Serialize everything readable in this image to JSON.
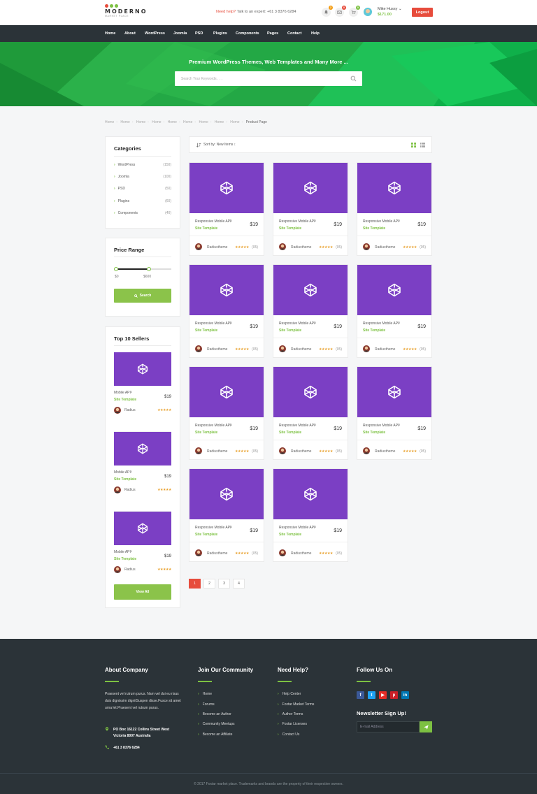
{
  "brand": {
    "name": "MODERNO",
    "tagline": "MARKET PLACE",
    "dot_colors": [
      "#e74c3c",
      "#7dc142",
      "#7dc142"
    ]
  },
  "header": {
    "help_prefix": "Need help?",
    "help_text": "Talk to an expert: +61 3 8376 6284",
    "notifications_count": "2",
    "messages_count": "0",
    "cart_count": "0",
    "user_name": "Mike Hussy",
    "user_balance": "$171.00",
    "logout_label": "Logout"
  },
  "nav": {
    "items": [
      "Home",
      "About",
      "WordPress",
      "Joomla",
      "PSD",
      "Plugins",
      "Components",
      "Pages",
      "Contact",
      "Help"
    ]
  },
  "hero": {
    "title": "Premium WordPress Themes, Web Templates and Many More ...",
    "search_placeholder": "Search Your Keywords . . ."
  },
  "breadcrumb": {
    "items": [
      "Home",
      "Home",
      "Home",
      "Home",
      "Home",
      "Home",
      "Home",
      "Home",
      "Home"
    ],
    "current": "Product Page"
  },
  "categories": {
    "title": "Categories",
    "items": [
      {
        "label": "WordPress",
        "count": "(150)"
      },
      {
        "label": "Joomla",
        "count": "(100)"
      },
      {
        "label": "PSD",
        "count": "(50)"
      },
      {
        "label": "Plugins",
        "count": "(60)"
      },
      {
        "label": "Components",
        "count": "(40)"
      }
    ]
  },
  "price_range": {
    "title": "Price Range",
    "min_label": "$0",
    "max_label": "$600",
    "selected_fraction": 0.6,
    "search_label": "Search"
  },
  "top_sellers": {
    "title": "Top 10 Sellers",
    "items": [
      {
        "title": "Mobile API²",
        "category": "Site Template",
        "price": "$19",
        "author": "Radius",
        "stars": "★★★★★"
      },
      {
        "title": "Mobile API²",
        "category": "Site Template",
        "price": "$19",
        "author": "Radius",
        "stars": "★★★★★"
      },
      {
        "title": "Mobile API²",
        "category": "Site Template",
        "price": "$19",
        "author": "Radius",
        "stars": "★★★★★"
      }
    ],
    "view_all_label": "View All"
  },
  "sort": {
    "label": "Sort by: New Items ↕"
  },
  "products": [
    {
      "title": "Responsive Mobile API²",
      "category": "Site Template",
      "price": "$19",
      "author": "Radiustheme",
      "stars": "★★★★★",
      "reviews": "(05)"
    },
    {
      "title": "Responsive Mobile API²",
      "category": "Site Template",
      "price": "$19",
      "author": "Radiustheme",
      "stars": "★★★★★",
      "reviews": "(05)"
    },
    {
      "title": "Responsive Mobile API²",
      "category": "Site Template",
      "price": "$19",
      "author": "Radiustheme",
      "stars": "★★★★★",
      "reviews": "(05)"
    },
    {
      "title": "Responsive Mobile API²",
      "category": "Site Template",
      "price": "$19",
      "author": "Radiustheme",
      "stars": "★★★★★",
      "reviews": "(05)"
    },
    {
      "title": "Responsive Mobile API²",
      "category": "Site Template",
      "price": "$19",
      "author": "Radiustheme",
      "stars": "★★★★★",
      "reviews": "(05)"
    },
    {
      "title": "Responsive Mobile API²",
      "category": "Site Template",
      "price": "$19",
      "author": "Radiustheme",
      "stars": "★★★★★",
      "reviews": "(05)"
    },
    {
      "title": "Responsive Mobile API²",
      "category": "Site Template",
      "price": "$19",
      "author": "Radiustheme",
      "stars": "★★★★★",
      "reviews": "(05)"
    },
    {
      "title": "Responsive Mobile API²",
      "category": "Site Template",
      "price": "$19",
      "author": "Radiustheme",
      "stars": "★★★★★",
      "reviews": "(05)"
    },
    {
      "title": "Responsive Mobile API²",
      "category": "Site Template",
      "price": "$19",
      "author": "Radiustheme",
      "stars": "★★★★★",
      "reviews": "(05)"
    },
    {
      "title": "Responsive Mobile API²",
      "category": "Site Template",
      "price": "$19",
      "author": "Radiustheme",
      "stars": "★★★★★",
      "reviews": "(05)"
    },
    {
      "title": "Responsive Mobile API²",
      "category": "Site Template",
      "price": "$19",
      "author": "Radiustheme",
      "stars": "★★★★★",
      "reviews": "(05)"
    }
  ],
  "pagination": {
    "pages": [
      "1",
      "2",
      "3",
      "4"
    ],
    "active": "1"
  },
  "footer": {
    "about": {
      "heading": "About Company",
      "text": "Praesent vel rutrum purus. Nam vel dui eu risus duis dignissim dignitSuspen disse.Fusce sit amet urna let.Praesent vel rutrum purus.",
      "address": [
        "PO Box 16122 Collins Street West",
        "Victoria 8007 Australia"
      ],
      "phone": "+61 3 8376 6284"
    },
    "community": {
      "heading": "Join Our Community",
      "links": [
        "Home",
        "Forums",
        "Become an Author",
        "Community Meetups",
        "Become an Affiliate"
      ]
    },
    "help": {
      "heading": "Need Help?",
      "links": [
        "Help Center",
        "Foxtar Market Terms",
        "Author Terms",
        "Foxtar Licenses",
        "Contact Us"
      ]
    },
    "follow": {
      "heading": "Follow Us On",
      "socials": [
        {
          "icon": "facebook-icon",
          "glyph": "f",
          "color": "#3b5998"
        },
        {
          "icon": "twitter-icon",
          "glyph": "t",
          "color": "#1da1f2"
        },
        {
          "icon": "youtube-icon",
          "glyph": "▶",
          "color": "#e52d27"
        },
        {
          "icon": "pinterest-icon",
          "glyph": "p",
          "color": "#cb2027"
        },
        {
          "icon": "linkedin-icon",
          "glyph": "in",
          "color": "#0077b5"
        }
      ]
    },
    "newsletter": {
      "heading": "Newsletter Sign Up!",
      "placeholder": "E-mail Address"
    },
    "copyright": "© 2017 Foxtar market place. Trademarks and brands are the property of their respective owners."
  },
  "colors": {
    "accent_green": "#7dc142",
    "danger_red": "#e74c3c",
    "product_purple": "#7b3fc4",
    "dark_bar": "#2b3338"
  }
}
